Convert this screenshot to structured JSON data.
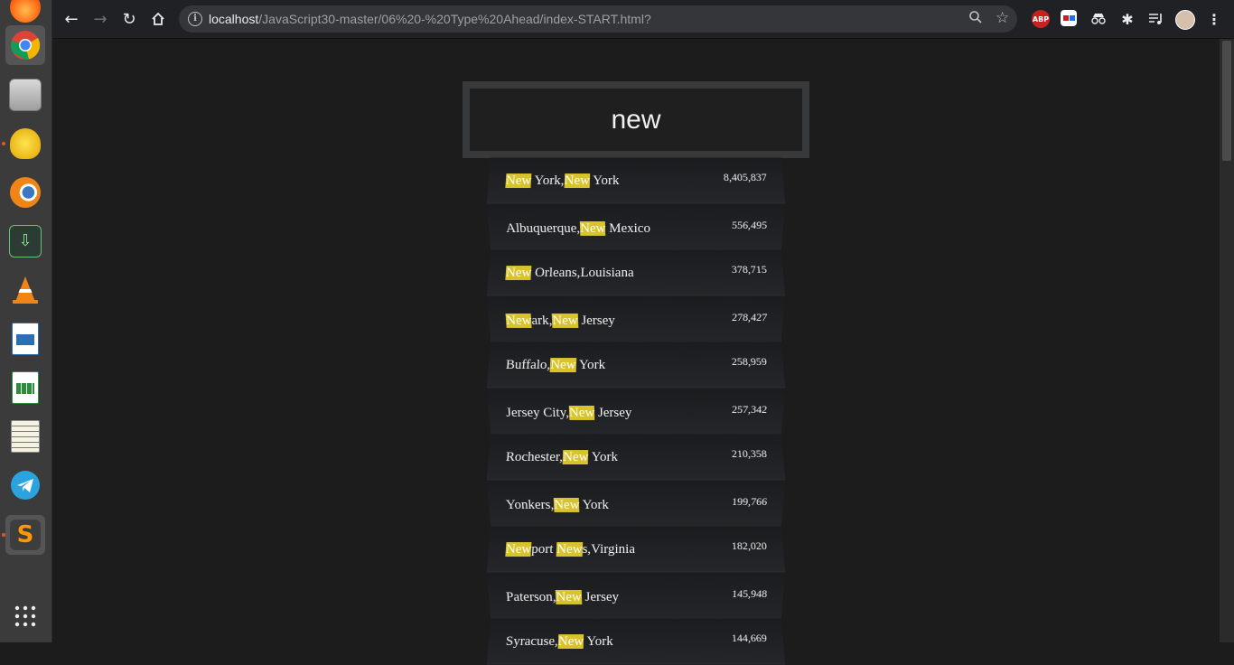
{
  "browser": {
    "url_host": "localhost",
    "url_path": "/JavaScript30-master/06%20-%20Type%20Ahead/index-START.html?",
    "extensions": [
      "ABP",
      "",
      "",
      "",
      "",
      ""
    ]
  },
  "search": {
    "value": "new"
  },
  "results": [
    {
      "parts": [
        {
          "t": "New",
          "h": true
        },
        {
          "t": " York,",
          "h": false
        },
        {
          "t": "New",
          "h": true
        },
        {
          "t": " York",
          "h": false
        }
      ],
      "population": "8,405,837"
    },
    {
      "parts": [
        {
          "t": "Albuquerque,",
          "h": false
        },
        {
          "t": "New",
          "h": true
        },
        {
          "t": " Mexico",
          "h": false
        }
      ],
      "population": "556,495"
    },
    {
      "parts": [
        {
          "t": "New",
          "h": true
        },
        {
          "t": " Orleans,Louisiana",
          "h": false
        }
      ],
      "population": "378,715"
    },
    {
      "parts": [
        {
          "t": "New",
          "h": true
        },
        {
          "t": "ark,",
          "h": false
        },
        {
          "t": "New",
          "h": true
        },
        {
          "t": " Jersey",
          "h": false
        }
      ],
      "population": "278,427"
    },
    {
      "parts": [
        {
          "t": "Buffalo,",
          "h": false
        },
        {
          "t": "New",
          "h": true
        },
        {
          "t": " York",
          "h": false
        }
      ],
      "population": "258,959"
    },
    {
      "parts": [
        {
          "t": "Jersey City,",
          "h": false
        },
        {
          "t": "New",
          "h": true
        },
        {
          "t": " Jersey",
          "h": false
        }
      ],
      "population": "257,342"
    },
    {
      "parts": [
        {
          "t": "Rochester,",
          "h": false
        },
        {
          "t": "New",
          "h": true
        },
        {
          "t": " York",
          "h": false
        }
      ],
      "population": "210,358"
    },
    {
      "parts": [
        {
          "t": "Yonkers,",
          "h": false
        },
        {
          "t": "New",
          "h": true
        },
        {
          "t": " York",
          "h": false
        }
      ],
      "population": "199,766"
    },
    {
      "parts": [
        {
          "t": "New",
          "h": true
        },
        {
          "t": "port ",
          "h": false
        },
        {
          "t": "New",
          "h": true
        },
        {
          "t": "s,Virginia",
          "h": false
        }
      ],
      "population": "182,020"
    },
    {
      "parts": [
        {
          "t": "Paterson,",
          "h": false
        },
        {
          "t": "New",
          "h": true
        },
        {
          "t": " Jersey",
          "h": false
        }
      ],
      "population": "145,948"
    },
    {
      "parts": [
        {
          "t": "Syracuse,",
          "h": false
        },
        {
          "t": "New",
          "h": true
        },
        {
          "t": " York",
          "h": false
        }
      ],
      "population": "144,669"
    }
  ],
  "colors": {
    "highlight": "#d8c32a",
    "page_bg": "#1c1c1d"
  }
}
